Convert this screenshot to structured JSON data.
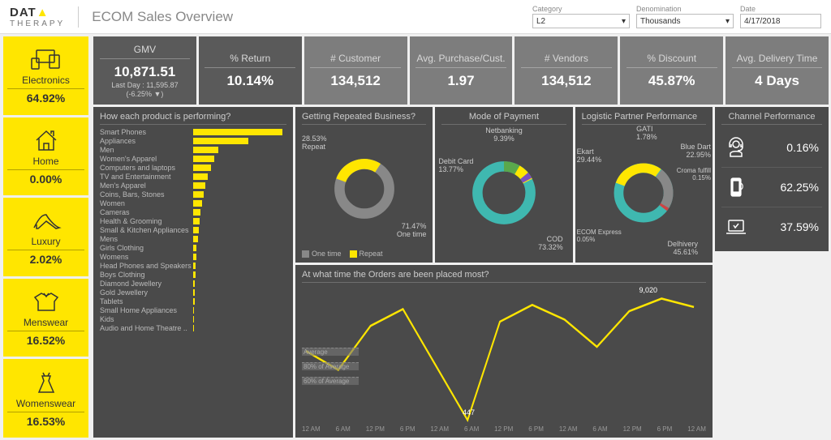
{
  "header": {
    "logo1": "DAT",
    "logo2": "THERAPY",
    "title": "ECOM Sales Overview",
    "filters": {
      "category": {
        "label": "Category",
        "value": "L2"
      },
      "denomination": {
        "label": "Denomination",
        "value": "Thousands"
      },
      "date": {
        "label": "Date",
        "value": "4/17/2018"
      }
    }
  },
  "sidebar": [
    {
      "name": "Electronics",
      "pct": "64.92%"
    },
    {
      "name": "Home",
      "pct": "0.00%"
    },
    {
      "name": "Luxury",
      "pct": "2.02%"
    },
    {
      "name": "Menswear",
      "pct": "16.52%"
    },
    {
      "name": "Womenswear",
      "pct": "16.53%"
    }
  ],
  "kpis": [
    {
      "label": "GMV",
      "value": "10,871.51",
      "sub": "Last Day : 11,595.87",
      "delta": "(-6.25% ▼)"
    },
    {
      "label": "% Return",
      "value": "10.14%"
    },
    {
      "label": "# Customer",
      "value": "134,512"
    },
    {
      "label": "Avg. Purchase/Cust.",
      "value": "1.97"
    },
    {
      "label": "# Vendors",
      "value": "134,512"
    },
    {
      "label": "% Discount",
      "value": "45.87%"
    },
    {
      "label": "Avg. Delivery Time",
      "value": "4 Days"
    }
  ],
  "product_perf": {
    "title": "How each product is performing?",
    "items": [
      {
        "n": "Smart Phones",
        "v": 100
      },
      {
        "n": "Appliances",
        "v": 62
      },
      {
        "n": "Men",
        "v": 28
      },
      {
        "n": "Women's Apparel",
        "v": 24
      },
      {
        "n": "Computers and laptops",
        "v": 20
      },
      {
        "n": "TV and Entertainment",
        "v": 16
      },
      {
        "n": "Men's Apparel",
        "v": 14
      },
      {
        "n": "Coins, Bars, Stones",
        "v": 12
      },
      {
        "n": "Women",
        "v": 10
      },
      {
        "n": "Cameras",
        "v": 8
      },
      {
        "n": "Health & Grooming",
        "v": 7
      },
      {
        "n": "Small & Kitchen Appliances",
        "v": 6
      },
      {
        "n": "Mens",
        "v": 5
      },
      {
        "n": "Girls Clothing",
        "v": 4
      },
      {
        "n": "Womens",
        "v": 4
      },
      {
        "n": "Head Phones and Speakers",
        "v": 3
      },
      {
        "n": "Boys Clothing",
        "v": 3
      },
      {
        "n": "Diamond Jewellery",
        "v": 2
      },
      {
        "n": "Gold Jewellery",
        "v": 2
      },
      {
        "n": "Tablets",
        "v": 2
      },
      {
        "n": "Small Home Appliances",
        "v": 1
      },
      {
        "n": "Kids",
        "v": 1
      },
      {
        "n": "Audio and Home Theatre ..",
        "v": 1
      }
    ]
  },
  "repeat": {
    "title": "Getting Repeated Business?",
    "one_time": "71.47%",
    "one_time_lbl": "One time",
    "repeat": "28.53%",
    "repeat_lbl": "Repeat",
    "legend_one": "One time",
    "legend_rep": "Repeat"
  },
  "payment": {
    "title": "Mode of Payment",
    "items": [
      {
        "n": "Netbanking",
        "v": "9.39%"
      },
      {
        "n": "Debit Card",
        "v": "13.77%"
      },
      {
        "n": "COD",
        "v": "73.32%"
      }
    ]
  },
  "logistic": {
    "title": "Logistic Partner Performance",
    "items": [
      {
        "n": "Ekart",
        "v": "29.44%"
      },
      {
        "n": "GATI",
        "v": "1.78%"
      },
      {
        "n": "Blue Dart",
        "v": "22.95%"
      },
      {
        "n": "Croma fulfill",
        "v": "0.15%"
      },
      {
        "n": "ECOM Express",
        "v": "0.05%"
      },
      {
        "n": "Delhivery",
        "v": "45.61%"
      }
    ]
  },
  "channel": {
    "title": "Channel Performance",
    "rows": [
      {
        "v": "0.16%"
      },
      {
        "v": "62.25%"
      },
      {
        "v": "37.59%"
      }
    ]
  },
  "time": {
    "title": "At what time the Orders are been placed most?",
    "peak": "9,020",
    "low": "447",
    "ref1": "Average",
    "ref2": "80% of Average",
    "ref3": "60% of Average",
    "axis": [
      "12 AM",
      "6 AM",
      "12 PM",
      "6 PM",
      "12 AM",
      "6 AM",
      "12 PM",
      "6 PM",
      "12 AM",
      "6 AM",
      "12 PM",
      "6 PM",
      "12 AM"
    ]
  },
  "chart_data": {
    "type": "composite_dashboard",
    "products_bar": {
      "type": "bar",
      "orientation": "horizontal",
      "categories": [
        "Smart Phones",
        "Appliances",
        "Men",
        "Women's Apparel",
        "Computers and laptops",
        "TV and Entertainment",
        "Men's Apparel",
        "Coins, Bars, Stones",
        "Women",
        "Cameras",
        "Health & Grooming",
        "Small & Kitchen Appliances",
        "Mens",
        "Girls Clothing",
        "Womens",
        "Head Phones and Speakers",
        "Boys Clothing",
        "Diamond Jewellery",
        "Gold Jewellery",
        "Tablets",
        "Small Home Appliances",
        "Kids",
        "Audio and Home Theatre"
      ],
      "values": [
        100,
        62,
        28,
        24,
        20,
        16,
        14,
        12,
        10,
        8,
        7,
        6,
        5,
        4,
        4,
        3,
        3,
        2,
        2,
        2,
        1,
        1,
        1
      ],
      "title": "How each product is performing?"
    },
    "repeat_donut": {
      "type": "pie",
      "categories": [
        "One time",
        "Repeat"
      ],
      "values": [
        71.47,
        28.53
      ],
      "title": "Getting Repeated Business?"
    },
    "payment_donut": {
      "type": "pie",
      "categories": [
        "COD",
        "Debit Card",
        "Netbanking"
      ],
      "values": [
        73.32,
        13.77,
        9.39
      ],
      "title": "Mode of Payment"
    },
    "logistic_donut": {
      "type": "pie",
      "categories": [
        "Delhivery",
        "Ekart",
        "Blue Dart",
        "GATI",
        "Croma fulfill",
        "ECOM Express"
      ],
      "values": [
        45.61,
        29.44,
        22.95,
        1.78,
        0.15,
        0.05
      ],
      "title": "Logistic Partner Performance"
    },
    "orders_time": {
      "type": "line",
      "title": "At what time the Orders are been placed most?",
      "x": [
        "12 AM",
        "6 AM",
        "12 PM",
        "6 PM",
        "12 AM",
        "6 AM",
        "12 PM",
        "6 PM",
        "12 AM",
        "6 AM",
        "12 PM",
        "6 PM",
        "12 AM"
      ],
      "values": [
        4000,
        2500,
        6500,
        8500,
        3000,
        447,
        7000,
        8800,
        7500,
        5000,
        8200,
        9020,
        8600
      ],
      "annotations": {
        "peak": 9020,
        "trough": 447
      },
      "references": {
        "Average": 5500,
        "80% of Average": 4400,
        "60% of Average": 3300
      }
    }
  }
}
